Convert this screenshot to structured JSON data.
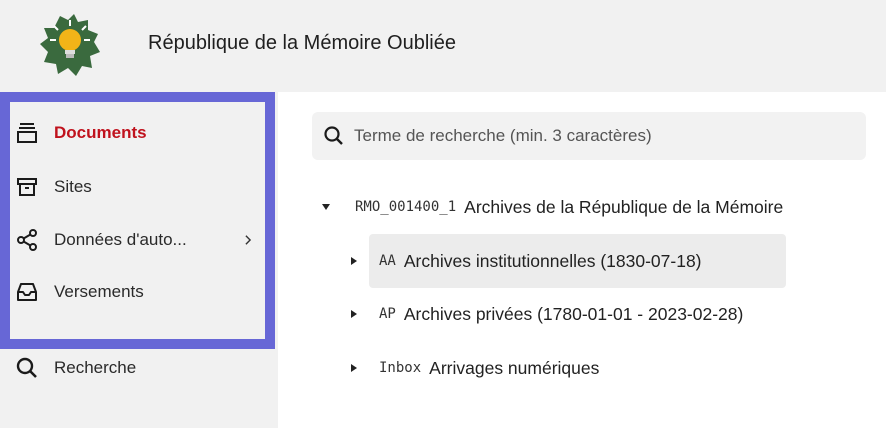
{
  "header": {
    "logo_icon": "lightbulb-on-green-map-icon",
    "title": "République de la Mémoire Oubliée"
  },
  "sidebar": {
    "highlight_color": "#6767d6",
    "items": [
      {
        "label": "Documents",
        "icon": "archive-stack-icon",
        "active": true
      },
      {
        "label": "Sites",
        "icon": "archive-box-icon",
        "active": false
      },
      {
        "label": "Données d'auto...",
        "icon": "share-nodes-icon",
        "active": false,
        "has_submenu": true
      },
      {
        "label": "Versements",
        "icon": "inbox-tray-icon",
        "active": false
      },
      {
        "label": "Recherche",
        "icon": "search-icon",
        "active": false
      }
    ],
    "active_color": "#c0121d"
  },
  "search": {
    "placeholder": "Terme de recherche (min. 3 caractères)",
    "value": ""
  },
  "tree": {
    "root": {
      "code": "RMO_001400_1",
      "label": "Archives de la République de la Mémoire",
      "expanded": true
    },
    "children": [
      {
        "code": "AA",
        "label": "Archives institutionnelles (1830-07-18)",
        "expanded": false,
        "highlighted": true
      },
      {
        "code": "AP",
        "label": "Archives privées (1780-01-01 - 2023-02-28)",
        "expanded": false
      },
      {
        "code": "Inbox",
        "label": "Arrivages numériques",
        "expanded": false
      }
    ]
  }
}
